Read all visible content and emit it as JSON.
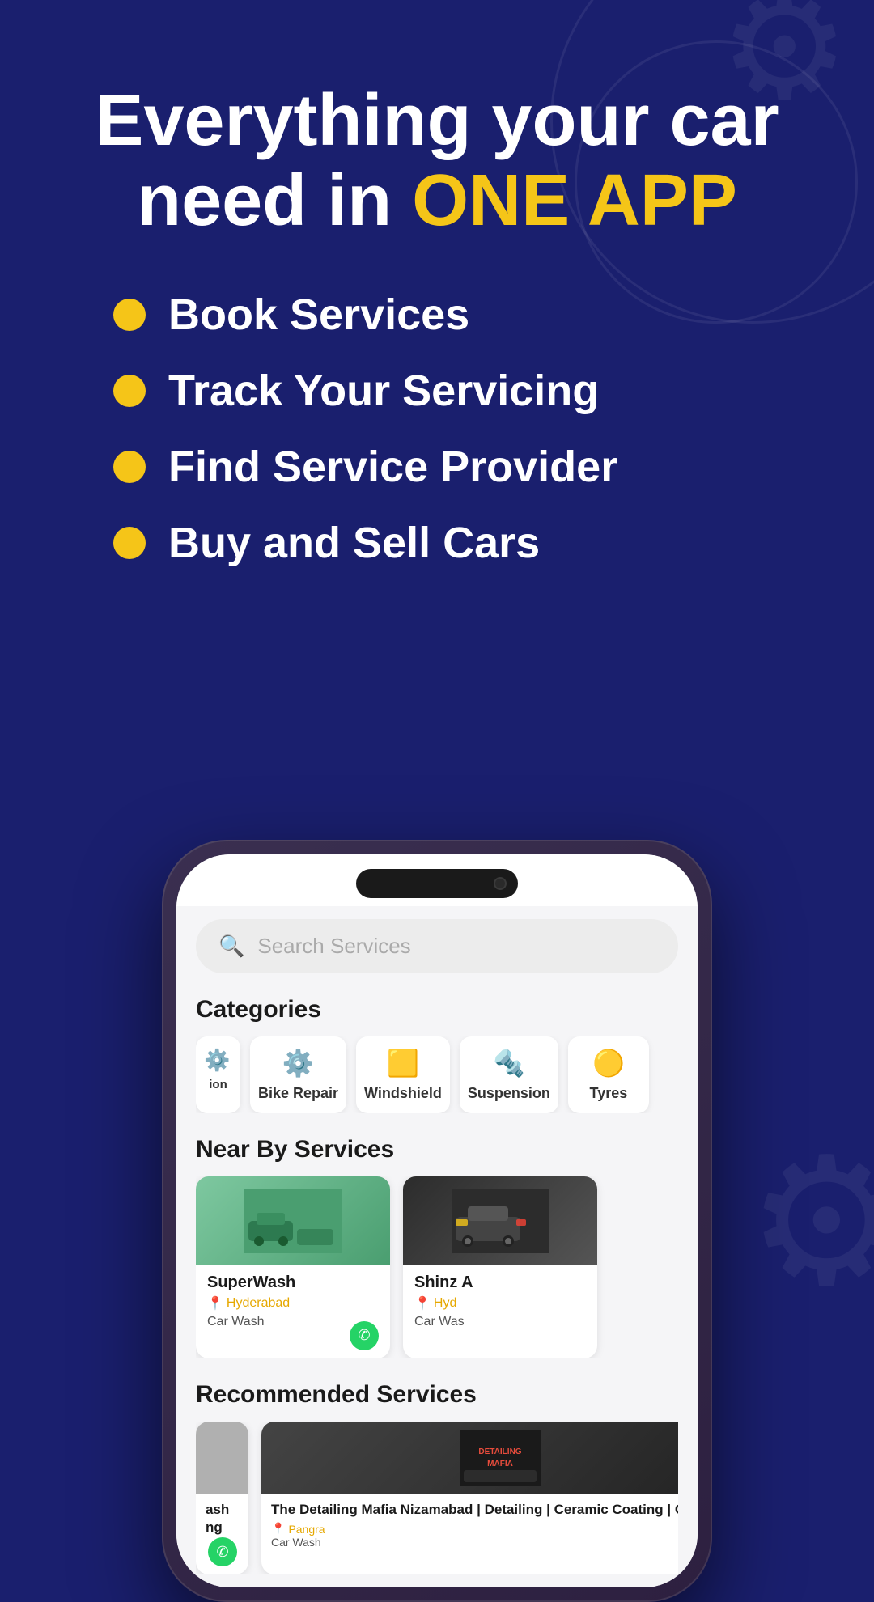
{
  "hero": {
    "title_line1": "Everything your car",
    "title_line2": "need in ",
    "title_highlight": "ONE APP",
    "features": [
      {
        "id": "book",
        "text": "Book Services"
      },
      {
        "id": "track",
        "text": "Track Your Servicing"
      },
      {
        "id": "find",
        "text": "Find Service Provider"
      },
      {
        "id": "buy",
        "text": "Buy and Sell Cars"
      }
    ]
  },
  "phone": {
    "search_placeholder": "Search Services",
    "sections": {
      "categories": {
        "title": "Categories",
        "items": [
          {
            "id": "cat-partial",
            "label": "ion",
            "icon": "⚙️",
            "partial": true
          },
          {
            "id": "cat-bike-repair",
            "label": "Bike Repair",
            "icon": "⚙️"
          },
          {
            "id": "cat-windshield",
            "label": "Windshield",
            "icon": "🪟"
          },
          {
            "id": "cat-suspension",
            "label": "Suspension",
            "icon": "🔩"
          },
          {
            "id": "cat-tyres",
            "label": "Tyres",
            "icon": "🔘"
          }
        ]
      },
      "nearby": {
        "title": "Near By Services",
        "items": [
          {
            "id": "superwash",
            "name": "SuperWash",
            "location": "Hyderabad",
            "type": "Car Wash",
            "img_type": "car-wash"
          },
          {
            "id": "shinz",
            "name": "Shinz A",
            "location": "Hyd",
            "type": "Car Was",
            "img_type": "bmw",
            "partial": true
          }
        ]
      },
      "recommended": {
        "title": "Recommended Services",
        "items": [
          {
            "id": "detailing-mafia",
            "name": "The Detailing Mafia Nizamabad | Detailing | Ceramic Coating | Car PPF",
            "location": "Pangra",
            "type": "Car Wash",
            "img_type": "detailing"
          },
          {
            "id": "partial-right",
            "name": "",
            "img_type": "red",
            "partial": true
          }
        ]
      }
    }
  },
  "colors": {
    "background": "#1a1f6e",
    "accent": "#f5c518",
    "white": "#ffffff",
    "card_bg": "#ffffff",
    "search_bg": "#ececec",
    "location_color": "#e6a800"
  }
}
